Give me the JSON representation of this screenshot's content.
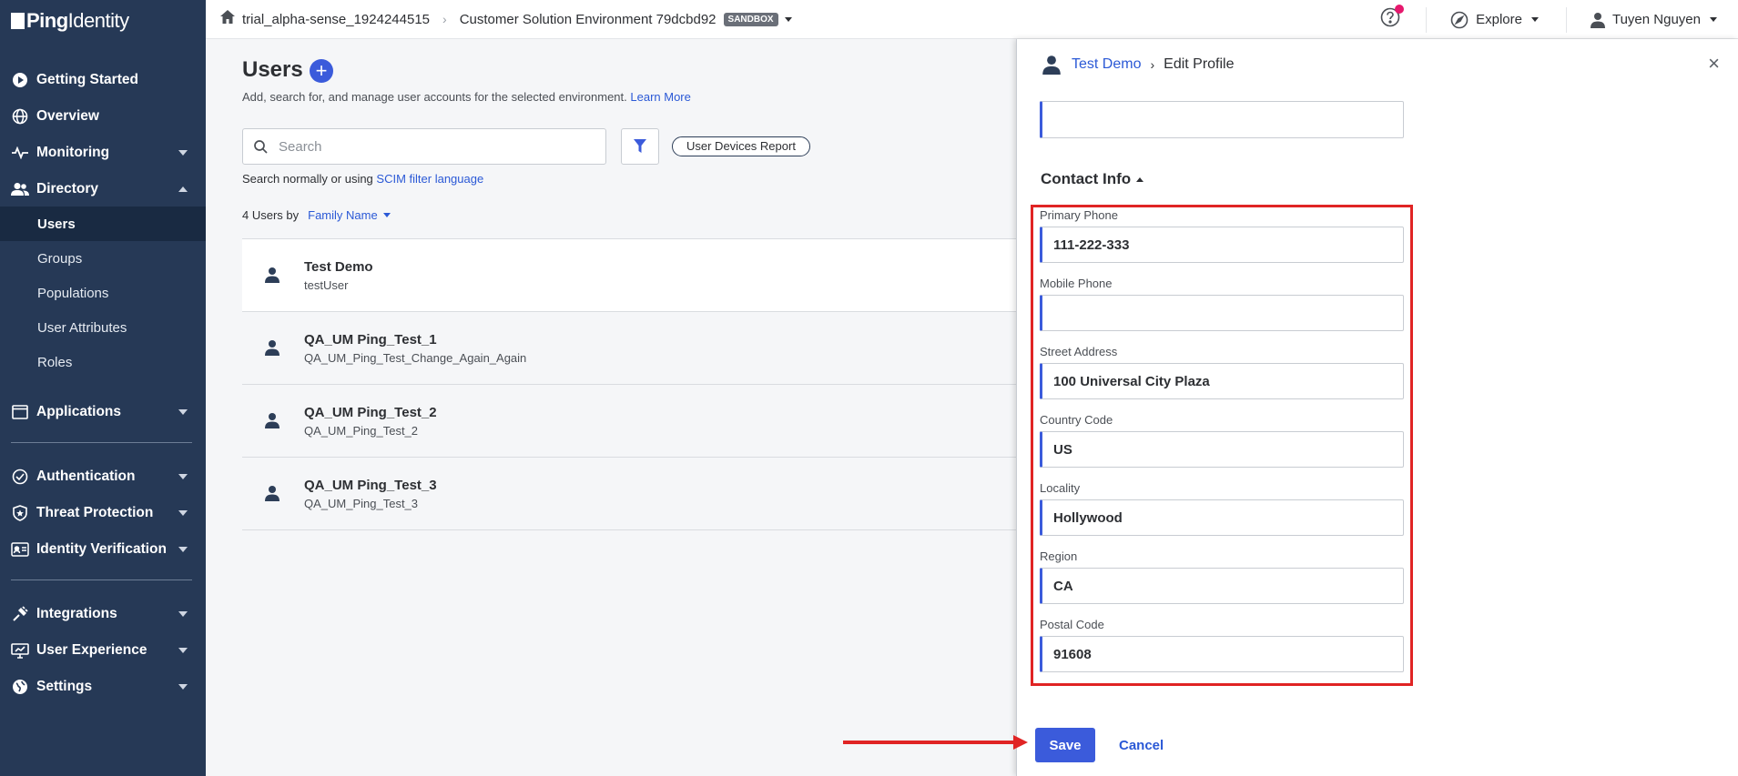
{
  "brand": {
    "bold": "Ping",
    "light": "Identity"
  },
  "topbar": {
    "environment": "trial_alpha-sense_1924244515",
    "solution": "Customer Solution Environment 79dcbd92",
    "badge": "SANDBOX",
    "explore": "Explore",
    "user": "Tuyen Nguyen"
  },
  "sidebar": {
    "getting_started": "Getting Started",
    "overview": "Overview",
    "monitoring": "Monitoring",
    "directory": "Directory",
    "users": "Users",
    "groups": "Groups",
    "populations": "Populations",
    "user_attributes": "User Attributes",
    "roles": "Roles",
    "applications": "Applications",
    "authentication": "Authentication",
    "threat_protection": "Threat Protection",
    "identity_verification": "Identity Verification",
    "integrations": "Integrations",
    "user_experience": "User Experience",
    "settings": "Settings"
  },
  "main": {
    "title": "Users",
    "subtitle": "Add, search for, and manage user accounts for the selected environment.",
    "learn_more": "Learn More",
    "search_placeholder": "Search",
    "report_button": "User Devices Report",
    "scim_prefix": "Search normally or using",
    "scim_link": "SCIM filter language",
    "count_label": "4 Users by",
    "sort_by": "Family Name",
    "users": [
      {
        "name": "Test Demo",
        "username": "testUser"
      },
      {
        "name": "QA_UM Ping_Test_1",
        "username": "QA_UM_Ping_Test_Change_Again_Again"
      },
      {
        "name": "QA_UM Ping_Test_2",
        "username": "QA_UM_Ping_Test_2"
      },
      {
        "name": "QA_UM Ping_Test_3",
        "username": "QA_UM_Ping_Test_3"
      }
    ]
  },
  "panel": {
    "breadcrumb_user": "Test Demo",
    "breadcrumb_page": "Edit Profile",
    "section": "Contact Info",
    "fields": {
      "primary_phone_label": "Primary Phone",
      "primary_phone": "111-222-333",
      "mobile_phone_label": "Mobile Phone",
      "mobile_phone": "",
      "street_address_label": "Street Address",
      "street_address": "100 Universal City Plaza",
      "country_code_label": "Country Code",
      "country_code": "US",
      "locality_label": "Locality",
      "locality": "Hollywood",
      "region_label": "Region",
      "region": "CA",
      "postal_code_label": "Postal Code",
      "postal_code": "91608"
    },
    "save": "Save",
    "cancel": "Cancel"
  },
  "colors": {
    "sidebar": "#263956",
    "accent": "#3b5bdb",
    "highlight": "#e02424"
  }
}
